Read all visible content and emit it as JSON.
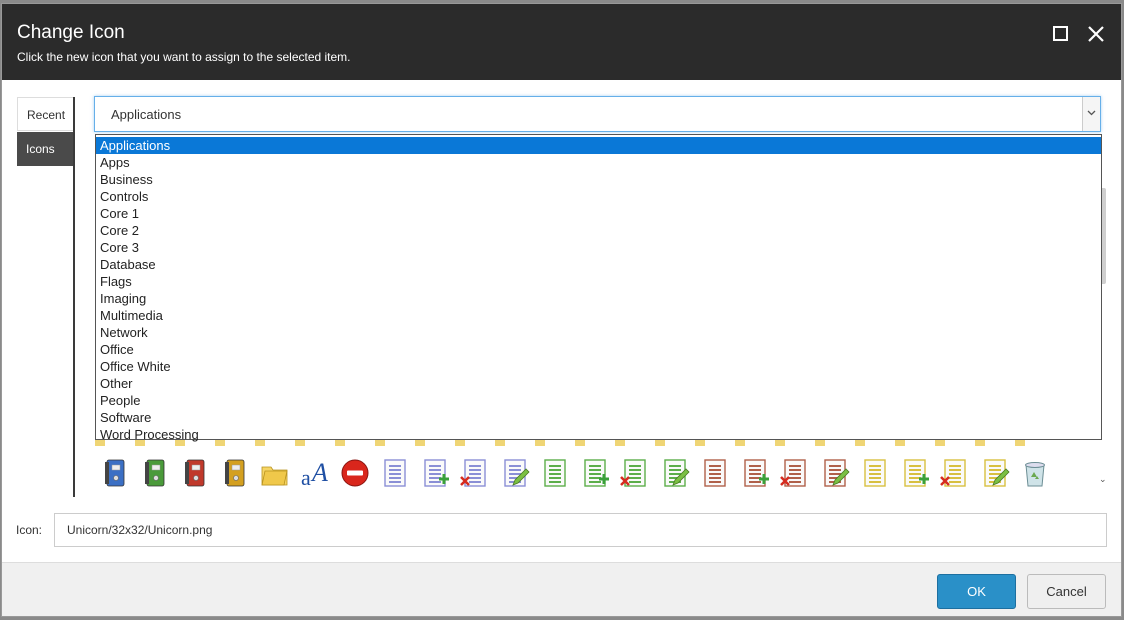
{
  "dialog": {
    "title": "Change Icon",
    "subtitle": "Click the new icon that you want to assign to the selected item."
  },
  "tabs": [
    {
      "label": "Recent"
    },
    {
      "label": "Icons",
      "active": true
    }
  ],
  "category_select": {
    "value": "Applications",
    "options": [
      "Applications",
      "Apps",
      "Business",
      "Controls",
      "Core 1",
      "Core 2",
      "Core 3",
      "Database",
      "Flags",
      "Imaging",
      "Multimedia",
      "Network",
      "Office",
      "Office White",
      "Other",
      "People",
      "Software",
      "Word Processing"
    ],
    "selected_index": 0
  },
  "icons": [
    {
      "name": "blue-binder-icon",
      "color": "#3b6fc4"
    },
    {
      "name": "green-binder-icon",
      "color": "#4a9a3a"
    },
    {
      "name": "red-binder-icon",
      "color": "#c0392b"
    },
    {
      "name": "yellow-binder-icon",
      "color": "#d4a020"
    },
    {
      "name": "folders-icon",
      "color": "#f0c84a"
    },
    {
      "name": "font-icon",
      "color": "#1f4fa3"
    },
    {
      "name": "no-entry-icon",
      "color": "#d9261c"
    },
    {
      "name": "blue-document-icon",
      "color": "#8a8fd6"
    },
    {
      "name": "blue-document-add-icon",
      "color": "#8a8fd6"
    },
    {
      "name": "blue-document-delete-icon",
      "color": "#8a8fd6"
    },
    {
      "name": "blue-document-edit-icon",
      "color": "#8a8fd6"
    },
    {
      "name": "green-document-icon",
      "color": "#5cae4a"
    },
    {
      "name": "green-document-add-icon",
      "color": "#5cae4a"
    },
    {
      "name": "green-document-delete-icon",
      "color": "#5cae4a"
    },
    {
      "name": "green-document-edit-icon",
      "color": "#5cae4a"
    },
    {
      "name": "red-document-icon",
      "color": "#b0604a"
    },
    {
      "name": "red-document-add-icon",
      "color": "#b0604a"
    },
    {
      "name": "red-document-delete-icon",
      "color": "#b0604a"
    },
    {
      "name": "red-document-edit-icon",
      "color": "#b0604a"
    },
    {
      "name": "yellow-document-icon",
      "color": "#d8c040"
    },
    {
      "name": "yellow-document-add-icon",
      "color": "#d8c040"
    },
    {
      "name": "yellow-document-delete-icon",
      "color": "#d8c040"
    },
    {
      "name": "yellow-document-edit-icon",
      "color": "#d8c040"
    },
    {
      "name": "recycle-bin-icon",
      "color": "#6aa84f"
    }
  ],
  "icon_field": {
    "label": "Icon:",
    "value": "Unicorn/32x32/Unicorn.png"
  },
  "buttons": {
    "ok": "OK",
    "cancel": "Cancel"
  },
  "colors": {
    "titlebar": "#2b2b2b",
    "selection": "#0a78d7",
    "ok_button": "#2a90c8"
  }
}
